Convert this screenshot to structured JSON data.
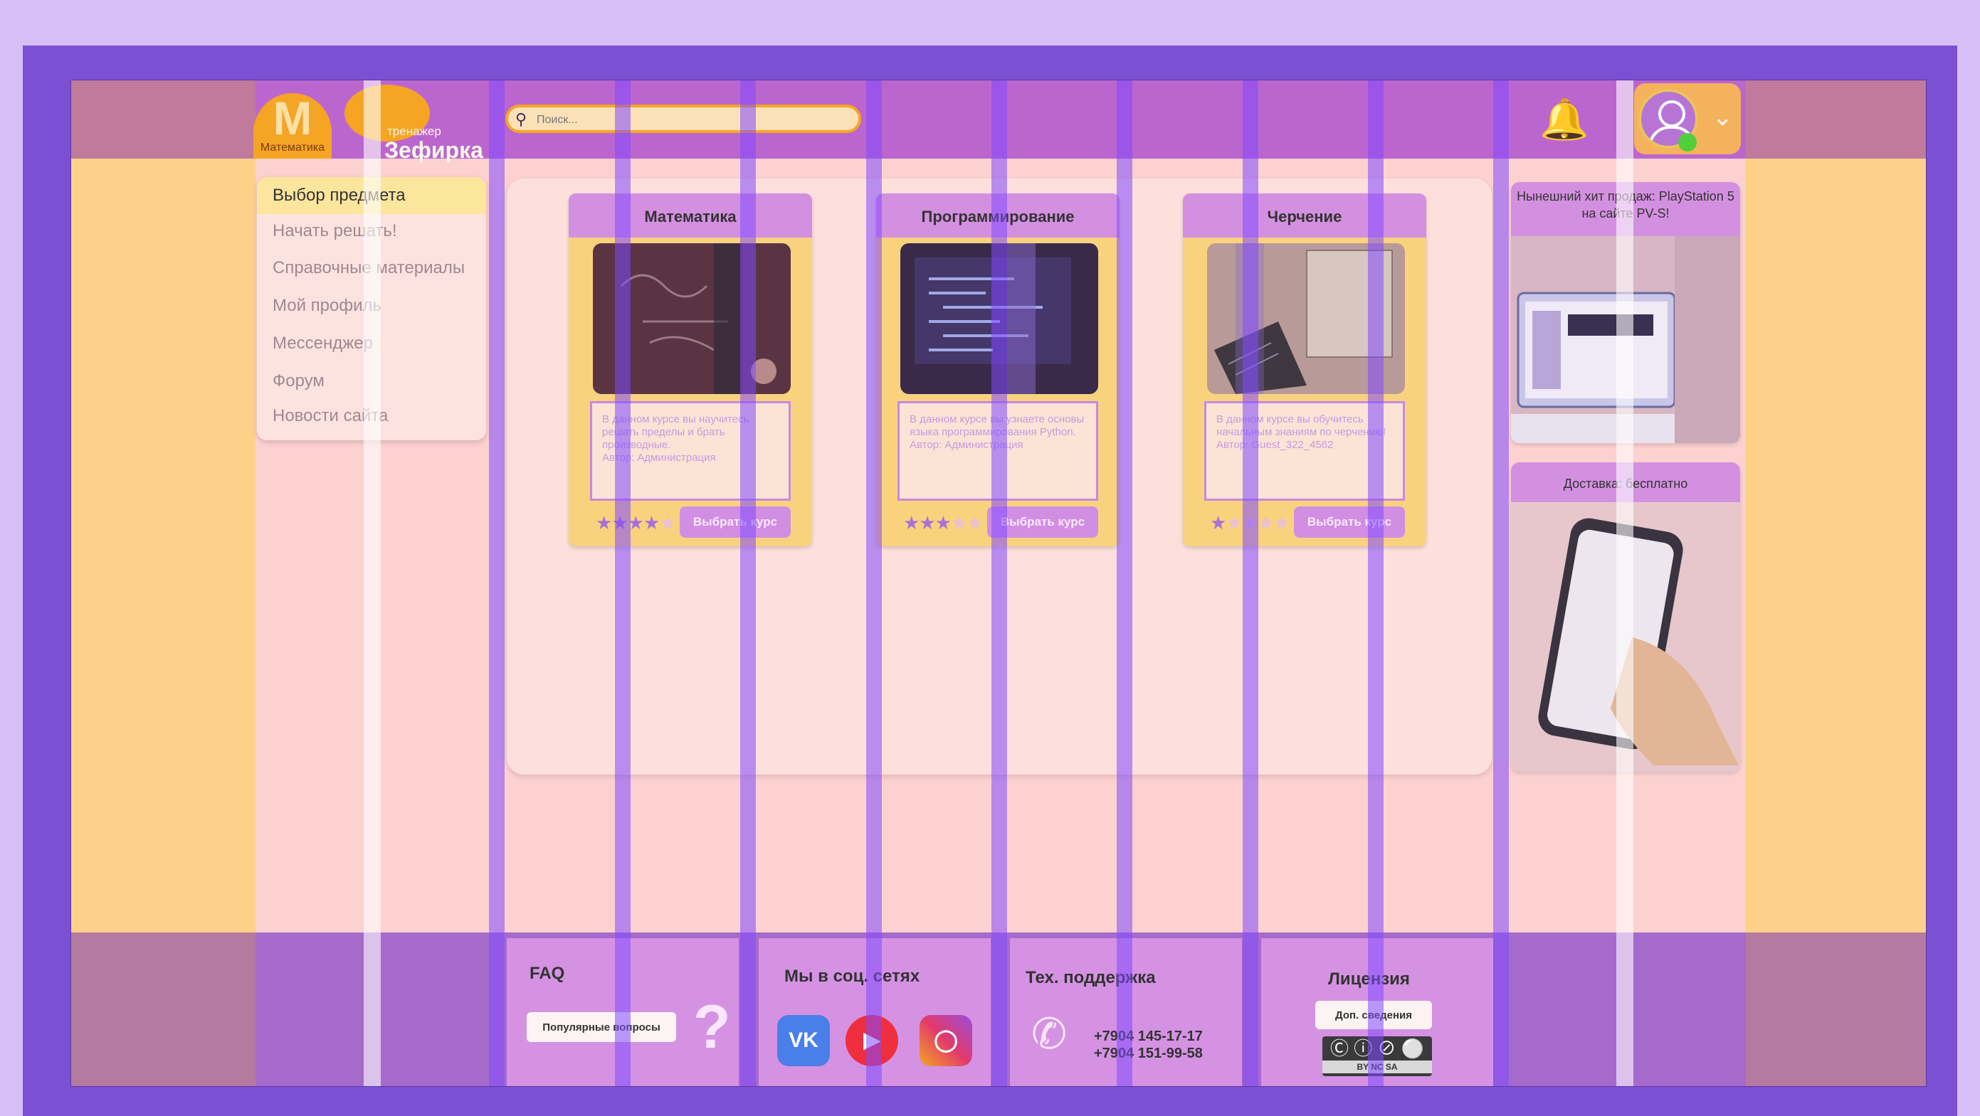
{
  "brand": {
    "logo_letter": "М",
    "logo_caption": "Математика",
    "trainer_small": "тренажер",
    "trainer_name": "Зефирка"
  },
  "search": {
    "placeholder": "Поиск..."
  },
  "menu": {
    "items": [
      {
        "label": "Выбор предмета",
        "active": true
      },
      {
        "label": "Начать решать!"
      },
      {
        "label": "Справочные материалы"
      },
      {
        "label": "Мой профиль"
      },
      {
        "label": "Мессенджер"
      },
      {
        "label": "Форум"
      },
      {
        "label": "Новости сайта"
      }
    ]
  },
  "cards": [
    {
      "title": "Математика",
      "description": "В данном курсе вы научитесь решать пределы и брать производные.\nАвтор: Администрация",
      "rating": 4,
      "button": "Выбрать курс"
    },
    {
      "title": "Программирование",
      "description": "В данном курсе вы узнаете основы языка программирования Python.\nАвтор: Администрация",
      "rating": 3,
      "button": "Выбрать курс"
    },
    {
      "title": "Черчение",
      "description": "В данном курсе вы обучитесь начальным знаниям по черчению!\nАвтор: Guest_322_4562",
      "rating": 1,
      "button": "Выбрать курс"
    }
  ],
  "ads": [
    {
      "caption": "Нынешний хит продаж: PlayStation 5 на сайте PV-S!"
    },
    {
      "caption": "Доставка: бесплатно"
    }
  ],
  "footer": {
    "faq": {
      "title": "FAQ",
      "button": "Популярные вопросы"
    },
    "social": {
      "title": "Мы в соц. сетях",
      "vk": "VK"
    },
    "support": {
      "title": "Тех. поддержка",
      "phone1": "+7904 145-17-17",
      "phone2": "+7904 151-99-58"
    },
    "license": {
      "title": "Лицензия",
      "button": "Доп. сведения",
      "badge": "BY  NC  SA"
    }
  },
  "colors": {
    "accent_orange": "#f6a423",
    "card_header": "#d490e0",
    "purple_frame": "#7b50d3"
  }
}
